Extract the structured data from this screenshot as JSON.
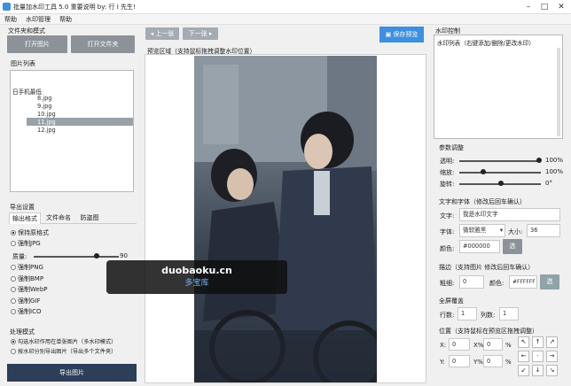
{
  "window": {
    "title": "批量加水印工具 5.0  重要说明 by: 行 I 先生!"
  },
  "menu": [
    "帮助",
    "水印管理",
    "帮助"
  ],
  "left": {
    "file_mode_title": "文件夹和模式",
    "open_image": "打开图片",
    "open_folder": "打开文件夹",
    "image_list_title": "图片列表",
    "tree_root": "日手机最低",
    "files": [
      "8.jpg",
      "9.jpg",
      "10.jpg",
      "11.jpg",
      "12.jpg"
    ],
    "export_title": "导出设置",
    "tabs": [
      "输出格式",
      "文件命名",
      "防盗图"
    ],
    "formats": [
      "保持原格式",
      "强制JPG",
      "强制PNG",
      "强制BMP",
      "强制WebP",
      "强制GIF",
      "强制ICO"
    ],
    "quality_label": "质量:",
    "quality_value": "90",
    "process_title": "处理模式",
    "process_options": [
      "勾选水印作用在单张图片（多水印模式）",
      "按水印分别导出图片（导出多个文件夹）"
    ],
    "export_button": "导出图片"
  },
  "center": {
    "prev": "◂ 上一张",
    "next": "下一张 ▸",
    "save_preview": "保存预览",
    "preview_label": "预览区域（支持鼠标拖拽调整水印位置）"
  },
  "watermark_overlay": {
    "site": "duobaoku.cn",
    "name": "多宝库"
  },
  "right": {
    "control_title": "水印控制",
    "list_label": "水印列表（右键添加/删除/更改水印）",
    "params_title": "参数调整",
    "opacity_label": "透明:",
    "opacity_value": "100%",
    "scale_label": "缩放:",
    "scale_value": "100%",
    "rotate_label": "旋转:",
    "rotate_value": "0°",
    "text_font_title": "文字和字体（修改后回车确认）",
    "text_label": "文字:",
    "text_value": "我是水印文字",
    "font_label": "字体:",
    "font_value": "微软雅黑",
    "size_label": "大小:",
    "size_value": "36",
    "color_label": "颜色:",
    "color_value": "#000000",
    "color_btn": "选",
    "stroke_title": "描边（支持图片 修改后回车确认）",
    "stroke_width_label": "粗细:",
    "stroke_width_value": "0",
    "stroke_color_label": "颜色:",
    "stroke_color_value": "#FFFFFF",
    "stroke_color_btn": "选",
    "tile_title": "全屏覆盖",
    "rows_label": "行数:",
    "rows_value": "1",
    "cols_label": "列数:",
    "cols_value": "1",
    "pos_title": "位置（支持鼠标在预览区拖拽调整）",
    "x_label": "X:",
    "x_value": "0",
    "xp_label": "X%:",
    "xp_value": "0",
    "y_label": "Y:",
    "y_value": "0",
    "yp_label": "Y%:",
    "yp_value": "0",
    "pct": "%",
    "pos_grid": [
      "↖",
      "↑",
      "↗",
      "←",
      "·",
      "→",
      "↙",
      "↓",
      "↘"
    ]
  },
  "colors": {
    "accent_blue": "#3d8fe0",
    "export_btn": "#2c3e58",
    "gray_btn": "#8c9298"
  }
}
